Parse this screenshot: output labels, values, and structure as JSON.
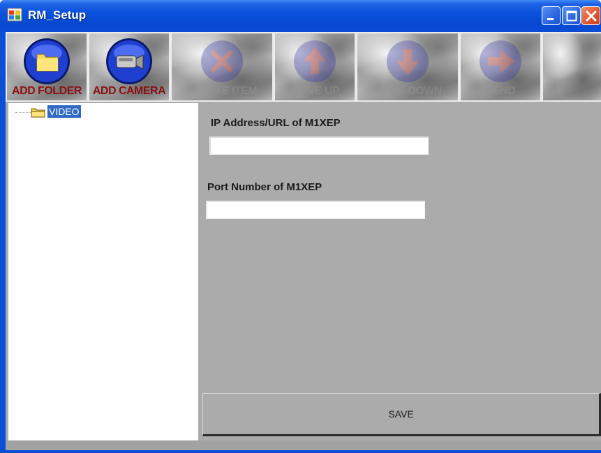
{
  "window": {
    "title": "RM_Setup",
    "accent": "#0b4fd6",
    "controls": [
      "minimize-icon",
      "maximize-icon",
      "close-icon"
    ]
  },
  "toolbar": {
    "buttons": [
      {
        "label": "ADD FOLDER",
        "icon": "folder-icon",
        "enabled": true
      },
      {
        "label": "ADD CAMERA",
        "icon": "camera-icon",
        "enabled": true
      },
      {
        "label": "DELETE ITEM",
        "icon": "delete-icon",
        "enabled": false
      },
      {
        "label": "MOVE UP",
        "icon": "move-up-icon",
        "enabled": false
      },
      {
        "label": "MOVE DOWN",
        "icon": "move-down-icon",
        "enabled": false
      },
      {
        "label": "SEND",
        "icon": "send-icon",
        "enabled": false
      }
    ]
  },
  "tree": {
    "items": [
      {
        "label": "VIDEO",
        "icon": "folder-icon",
        "selected": true
      }
    ]
  },
  "form": {
    "ip_label": "IP Address/URL of M1XEP",
    "ip_value": "",
    "port_label": "Port Number of M1XEP",
    "port_value": "",
    "save_label": "SAVE"
  }
}
